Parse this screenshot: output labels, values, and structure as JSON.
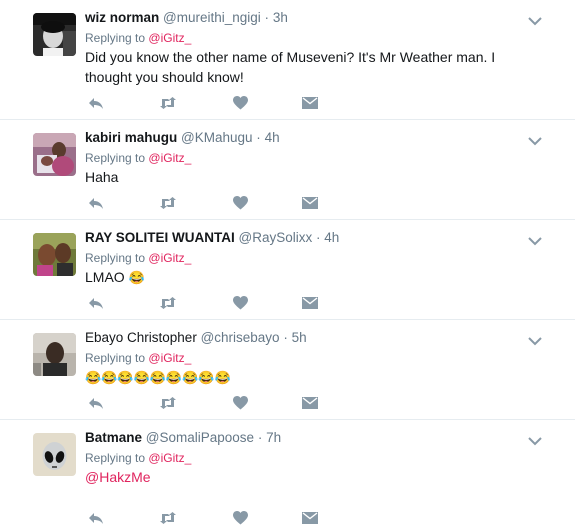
{
  "icons": {
    "reply": "reply-arrow-icon",
    "retweet": "retweet-icon",
    "like": "heart-icon",
    "dm": "envelope-icon",
    "more": "chevron-down-icon"
  },
  "colors": {
    "mention": "#e0245e",
    "muted": "#8899a6",
    "divider": "#e6ecf0"
  },
  "replies": [
    {
      "name": "wiz norman",
      "handle": "@mureithi_ngigi",
      "sep": "·",
      "time": "3h",
      "replying_label": "Replying to",
      "replying_to": "@iGitz_",
      "text": "Did you know the other name of Museveni? It's Mr Weather man. I thought you should know!"
    },
    {
      "name": "kabiri mahugu",
      "handle": "@KMahugu",
      "sep": "·",
      "time": "4h",
      "replying_label": "Replying to",
      "replying_to": "@iGitz_",
      "text": "Haha"
    },
    {
      "name": "RAY SOLITEI WUANTAI",
      "handle": "@RaySolixx",
      "sep": "·",
      "time": "4h",
      "replying_label": "Replying to",
      "replying_to": "@iGitz_",
      "text": "LMAO",
      "emoji": "😂"
    },
    {
      "name": "Ebayo Christopher",
      "handle": "@chrisebayo",
      "sep": "·",
      "time": "5h",
      "replying_label": "Replying to",
      "replying_to": "@iGitz_",
      "emoji": "😂😂😂😂😂😂😂😂😂"
    },
    {
      "name": "Batmane",
      "handle": "@SomaliPapoose",
      "sep": "·",
      "time": "7h",
      "replying_label": "Replying to",
      "replying_to": "@iGitz_",
      "text": "@HakzMe"
    }
  ]
}
